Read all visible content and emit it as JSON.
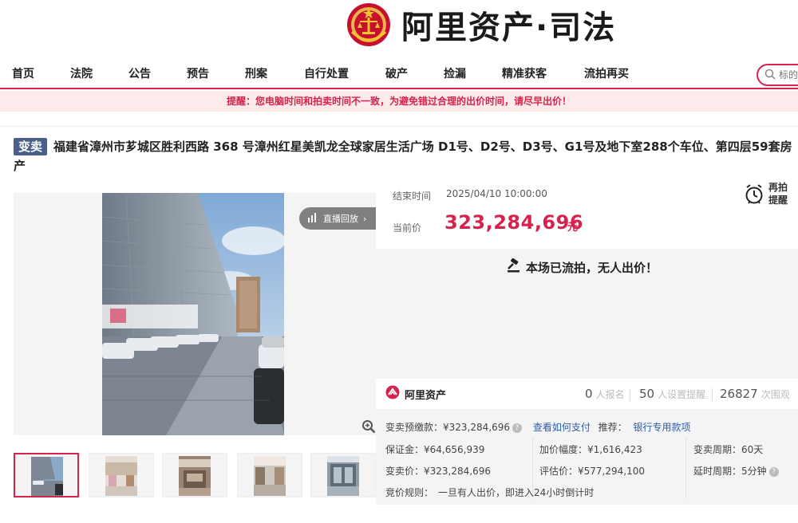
{
  "header": {
    "logo_text": "阿里资产·司法",
    "logo_icon": "court-emblem-icon",
    "brand_color": "#d6234d"
  },
  "nav": {
    "items": [
      "首页",
      "法院",
      "公告",
      "预告",
      "刑案",
      "自行处置",
      "破产",
      "捡漏",
      "精准获客",
      "流拍再买"
    ],
    "search_placeholder": "标的"
  },
  "notice": {
    "text": "提醒：您电脑时间和拍卖时间不一致，为避免错过合理的出价时间，请尽早出价！"
  },
  "listing": {
    "tag": "变卖",
    "title": "福建省漳州市芗城区胜利西路 368 号漳州红星美凯龙全球家居生活广场 D1号、D2号、D3号、G1号及地下室288个车位、第四层59套房产"
  },
  "gallery": {
    "live_replay_label": "直播回放",
    "thumb_count": 5
  },
  "auction": {
    "end_time_label": "结束时间",
    "end_time": "2025/04/10 10:00:00",
    "current_price_label": "当前价",
    "current_price": "323,284,696",
    "currency_unit": "元",
    "remind_label": "再拍提醒",
    "status_text": "本场已流拍，无人出价！"
  },
  "stats": {
    "logo_text": "阿里资产",
    "signups": "0",
    "signups_label": "人报名",
    "reminders": "50",
    "reminders_label": "人设置提醒",
    "views": "26827",
    "views_label": "次围观"
  },
  "details": {
    "deposit_label": "变卖预缴款：",
    "deposit_value": "¥323,284,696",
    "how_to_pay": "查看如何支付",
    "recommend_label": "推荐：",
    "bank_account": "银行专用款项",
    "bond_label": "保证金：",
    "bond_value": "¥64,656,939",
    "increment_label": "加价幅度：",
    "increment_value": "¥1,616,423",
    "sale_period_label": "变卖周期：",
    "sale_period_value": "60天",
    "sale_price_label": "变卖价：",
    "sale_price_value": "¥323,284,696",
    "appraisal_label": "评估价：",
    "appraisal_value": "¥577,294,100",
    "delay_label": "延时周期：",
    "delay_value": "5分钟",
    "rule_label": "竞价规则：",
    "rule_value": "一旦有人出价，即进入24小时倒计时"
  }
}
